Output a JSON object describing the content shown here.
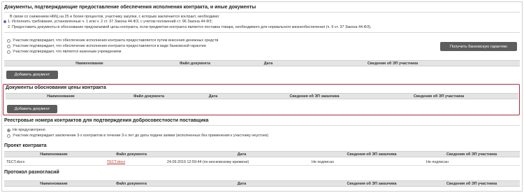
{
  "sec1": {
    "title": "Документы, подтверждающие предоставление обеспечения исполнения контракта, и иные документы",
    "note_intro": "В связи со снижением НМЦ на 25 и более процентов, участнику закупки, с которым заключается контракт, необходимо:",
    "note_item1": "1. Исполнить требования, установленные ч. 1 или ч. 2 ст. 37 Закона 44-ФЗ, с учетом положений ст. 96 Закона 44-ФЗ;",
    "note_item2": "2. Предоставить документы в обоснование предлагаемой цены контракта, если предметом контракта является поставка товара, необходимого для нормального жизнеобеспечения (ч. 9 ст. 37 Закона 44-ФЗ).",
    "radio1": "Участник подтверждает, что обеспечение исполнения контракта предоставляется путем внесения денежных средств",
    "radio2": "Участник подтверждает, что обеспечение исполнения контракта предоставляется в виде банковской гарантии",
    "radio3": "Участник подтверждает, что является казенным учреждением",
    "bank_btn": "Получить банковскую гарантию",
    "cols": [
      "Наименование",
      "Файл документа",
      "Дата",
      "Сведения об ЭП участника"
    ],
    "add_btn": "Добавить документ"
  },
  "sec2": {
    "title": "Документы обоснования цены контракта",
    "cols": [
      "Наименование",
      "Файл документа",
      "Дата",
      "Сведения об ЭП заказчика",
      "Сведения об ЭП участника"
    ],
    "add_btn": "Добавить документ"
  },
  "sec3": {
    "title": "Реестровые номера контрактов для подтверждения добросовестности поставщика",
    "radio1": "Не предусмотрено",
    "radio2": "Участник подтверждает заключение 3-х контрактов в течение 3-х лет до даты подачи заявки (исполненных без применения к участнику неустоек)"
  },
  "sec4": {
    "title": "Проект контракта",
    "cols": [
      "Наименование",
      "Файл документа",
      "Дата",
      "Сведения об ЭП заказчика",
      "Сведения об ЭП участника"
    ],
    "row": {
      "name": "ТЕСТ.docx",
      "file": "ТЕСТ.docx",
      "date": "24.09.2019 12:59:44 (по московскому времени)",
      "ep_customer": "Не подписан",
      "ep_participant": "Не подписан"
    }
  },
  "sec5": {
    "title": "Протокол разногласий",
    "cols": [
      "Наименование",
      "Файл документа",
      "Дата",
      "Сведения об ЭП заказчика",
      "Сведения об ЭП участника"
    ]
  }
}
